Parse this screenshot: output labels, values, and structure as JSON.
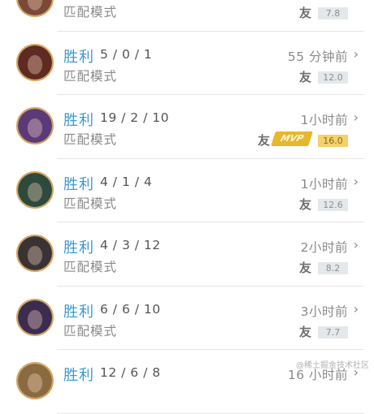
{
  "matches": [
    {
      "result": "",
      "kda": "",
      "time": "",
      "mode": "匹配模式",
      "badge": "友",
      "score": "7.8",
      "mvp": false,
      "mvp_label": "",
      "avatar_color": "#7a4a38"
    },
    {
      "result": "胜利",
      "kda": "5 / 0 / 1",
      "time": "55 分钟前",
      "mode": "匹配模式",
      "badge": "友",
      "score": "12.0",
      "mvp": false,
      "mvp_label": "",
      "avatar_color": "#5e2a22"
    },
    {
      "result": "胜利",
      "kda": "19 / 2 / 10",
      "time": "1小时前",
      "mode": "匹配模式",
      "badge": "友",
      "score": "16.0",
      "mvp": true,
      "mvp_label": "MVP",
      "avatar_color": "#5b3a78"
    },
    {
      "result": "胜利",
      "kda": "4 / 1 / 4",
      "time": "1小时前",
      "mode": "匹配模式",
      "badge": "友",
      "score": "12.6",
      "mvp": false,
      "mvp_label": "",
      "avatar_color": "#2d4a3c"
    },
    {
      "result": "胜利",
      "kda": "4 / 3 / 12",
      "time": "2小时前",
      "mode": "匹配模式",
      "badge": "友",
      "score": "8.2",
      "mvp": false,
      "mvp_label": "",
      "avatar_color": "#3a3333"
    },
    {
      "result": "胜利",
      "kda": "6 / 6 / 10",
      "time": "3小时前",
      "mode": "匹配模式",
      "badge": "友",
      "score": "7.7",
      "mvp": false,
      "mvp_label": "",
      "avatar_color": "#3c2c50"
    },
    {
      "result": "胜利",
      "kda": "12 / 6 / 8",
      "time": "16 小时前",
      "mode": "",
      "badge": "",
      "score": "",
      "mvp": false,
      "mvp_label": "",
      "avatar_color": "#8a6a40"
    }
  ],
  "chevron": "›",
  "watermark": "@稀土掘金技术社区"
}
